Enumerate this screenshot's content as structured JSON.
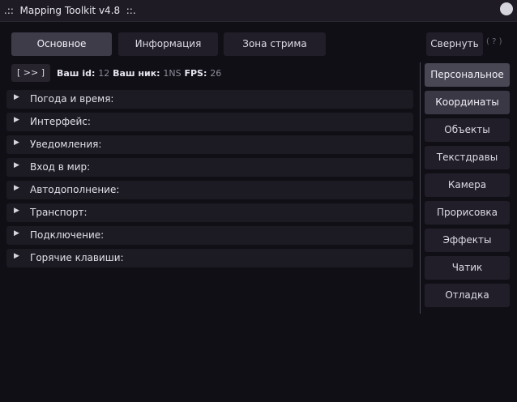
{
  "window": {
    "title": ".::  Mapping Toolkit v4.8  ::."
  },
  "tabs": [
    {
      "label": "Основное"
    },
    {
      "label": "Информация"
    },
    {
      "label": "Зона стрима"
    }
  ],
  "collapse_label": "Свернуть",
  "help_label": "( ? )",
  "toggle_label": "[ >> ]",
  "status": {
    "id_label": "Ваш id:",
    "id_value": "12",
    "nick_label": "Ваш ник:",
    "nick_value": "1NS",
    "fps_label": "FPS:",
    "fps_value": "26"
  },
  "sections": [
    {
      "label": "Погода и время:"
    },
    {
      "label": "Интерфейс:"
    },
    {
      "label": "Уведомления:"
    },
    {
      "label": "Вход в мир:"
    },
    {
      "label": "Автодополнение:"
    },
    {
      "label": "Транспорт:"
    },
    {
      "label": "Подключение:"
    },
    {
      "label": "Горячие клавиши:"
    }
  ],
  "sidebar": [
    {
      "label": "Персональное"
    },
    {
      "label": "Координаты"
    },
    {
      "label": "Объекты"
    },
    {
      "label": "Текстдравы"
    },
    {
      "label": "Камера"
    },
    {
      "label": "Прорисовка"
    },
    {
      "label": "Эффекты"
    },
    {
      "label": "Чатик"
    },
    {
      "label": "Отладка"
    }
  ],
  "colors": {
    "background": "#110f16",
    "active": "#4a4755",
    "button": "#211e29",
    "muted": "#8e8a99"
  }
}
